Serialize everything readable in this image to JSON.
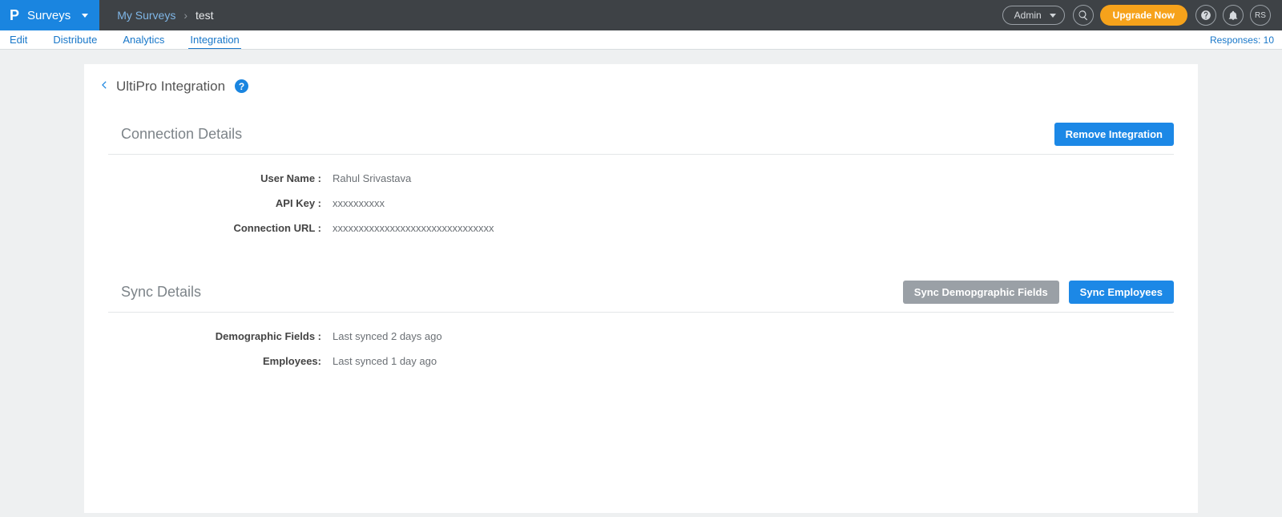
{
  "topbar": {
    "brand_label": "Surveys",
    "breadcrumb_root": "My Surveys",
    "breadcrumb_current": "test",
    "admin_label": "Admin",
    "upgrade_label": "Upgrade Now",
    "avatar_initials": "RS"
  },
  "subnav": {
    "items": [
      "Edit",
      "Distribute",
      "Analytics",
      "Integration"
    ],
    "active_index": 3,
    "responses_label": "Responses: 10"
  },
  "page": {
    "title": "UltiPro Integration"
  },
  "connection": {
    "heading": "Connection Details",
    "remove_btn": "Remove Integration",
    "rows": {
      "user_name_label": "User Name :",
      "user_name_value": "Rahul Srivastava",
      "api_key_label": "API Key :",
      "api_key_value": "xxxxxxxxxx",
      "url_label": "Connection URL :",
      "url_value": "xxxxxxxxxxxxxxxxxxxxxxxxxxxxxxx"
    }
  },
  "sync": {
    "heading": "Sync Details",
    "demo_btn": "Sync Demopgraphic Fields",
    "emp_btn": "Sync Employees",
    "rows": {
      "demo_label": "Demographic Fields :",
      "demo_value": "Last synced 2 days ago",
      "emp_label": "Employees:",
      "emp_value": "Last synced 1 day ago"
    }
  }
}
